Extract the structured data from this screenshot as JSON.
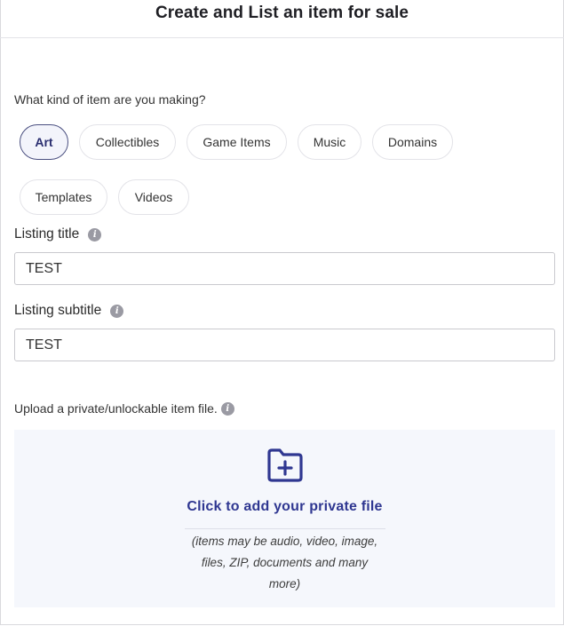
{
  "header": {
    "title": "Create and List an item for sale"
  },
  "category": {
    "question": "What kind of item are you making?",
    "options": [
      {
        "label": "Art",
        "selected": true
      },
      {
        "label": "Collectibles",
        "selected": false
      },
      {
        "label": "Game Items",
        "selected": false
      },
      {
        "label": "Music",
        "selected": false
      },
      {
        "label": "Domains",
        "selected": false
      },
      {
        "label": "Templates",
        "selected": false
      },
      {
        "label": "Videos",
        "selected": false
      }
    ]
  },
  "listing_title": {
    "label": "Listing title",
    "value": "TEST",
    "icon": "info-icon"
  },
  "listing_subtitle": {
    "label": "Listing subtitle",
    "value": "TEST",
    "icon": "info-icon"
  },
  "upload": {
    "label": "Upload a private/unlockable item file.",
    "icon": "info-icon",
    "dropzone_icon": "folder-plus-icon",
    "cta": "Click to add your private file",
    "hint_lines": [
      "(items may be audio, video, image,",
      "files, ZIP, documents and many",
      "more)"
    ]
  },
  "colors": {
    "accent": "#2f3791",
    "dropzone_bg": "#f5f7fc",
    "chip_border": "#e3e3e8",
    "info_icon": "#9a9aa3"
  }
}
